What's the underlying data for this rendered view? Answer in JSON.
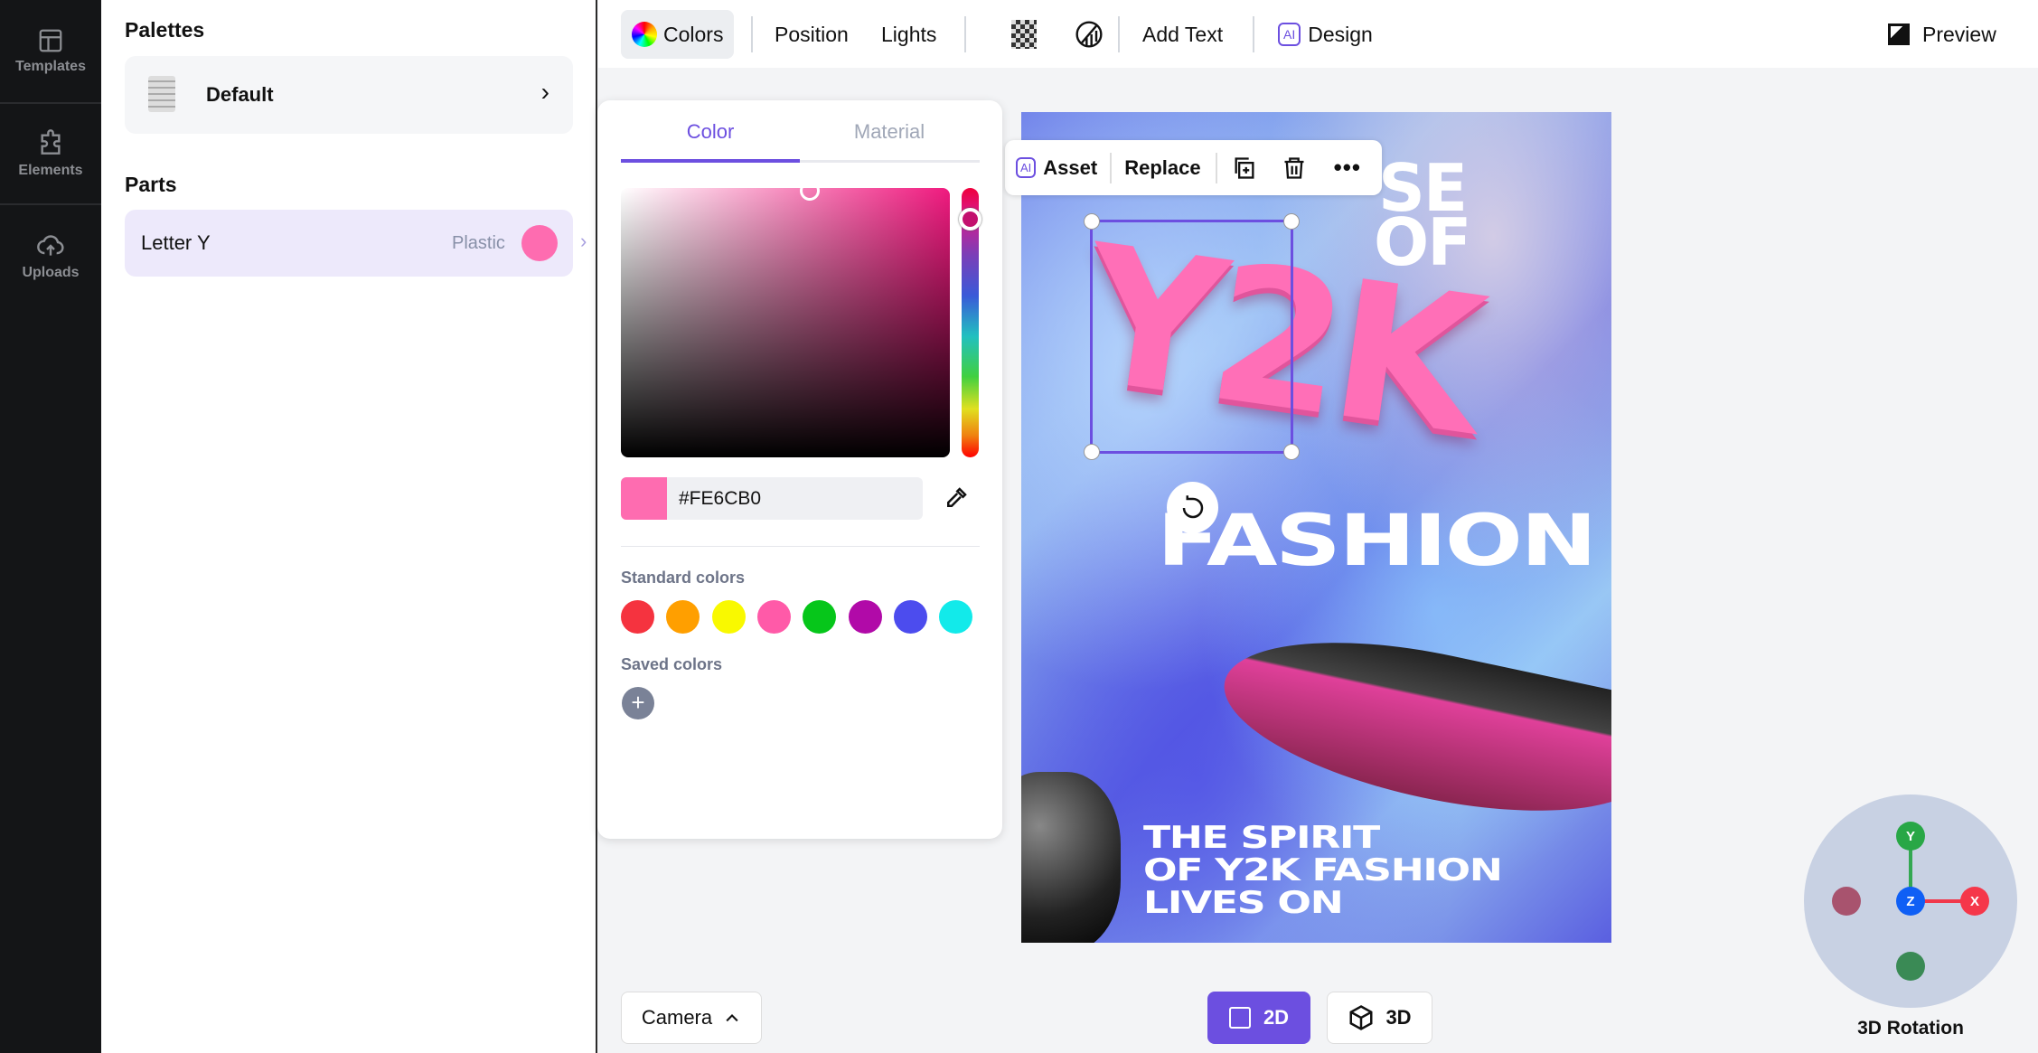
{
  "sidebar": {
    "items": [
      {
        "label": "Templates",
        "icon": "layout-icon"
      },
      {
        "label": "Elements",
        "icon": "puzzle-icon"
      },
      {
        "label": "Uploads",
        "icon": "cloud-upload-icon"
      }
    ]
  },
  "panel": {
    "palettes_title": "Palettes",
    "palette": {
      "name": "Default"
    },
    "parts_title": "Parts",
    "part": {
      "name": "Letter Y",
      "material": "Plastic",
      "color": "#FE6CB0"
    }
  },
  "toolbar": {
    "colors": "Colors",
    "position": "Position",
    "lights": "Lights",
    "add_text": "Add Text",
    "ai_badge": "AI",
    "design": "Design",
    "preview": "Preview"
  },
  "color_panel": {
    "tabs": [
      "Color",
      "Material"
    ],
    "active_tab": "Color",
    "hex_value": "#FE6CB0",
    "standard_label": "Standard colors",
    "standard_colors": [
      "#f5333f",
      "#ff9f00",
      "#f9f900",
      "#ff5aa8",
      "#06c61a",
      "#b10aa8",
      "#4c4cee",
      "#12eaea"
    ],
    "saved_label": "Saved colors",
    "accent": "#6c4fe0"
  },
  "asset_bar": {
    "ai_badge": "AI",
    "asset": "Asset",
    "replace": "Replace"
  },
  "poster": {
    "line1": "SE",
    "line2": "OF",
    "headline": "Y2K",
    "line3": "FASHION",
    "tagline": [
      "THE SPIRIT",
      "OF Y2K FASHION",
      "LIVES ON"
    ]
  },
  "bottom": {
    "camera": "Camera",
    "mode_2d": "2D",
    "mode_3d": "3D",
    "active_mode": "2D"
  },
  "rotation": {
    "label": "3D Rotation",
    "x": "X",
    "y": "Y",
    "z": "Z"
  }
}
